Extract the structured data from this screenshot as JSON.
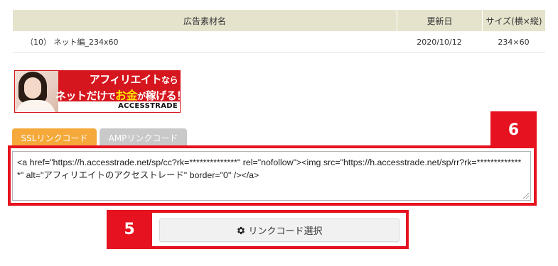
{
  "table": {
    "headers": [
      "広告素材名",
      "更新日",
      "サイズ(横×縦)"
    ],
    "rows": [
      [
        "（10） ネット編_234x60",
        "2020/10/12",
        "234×60"
      ]
    ]
  },
  "banner": {
    "line1_main": "アフィリエイト",
    "line1_small": "なら",
    "line2_a": "ネットだけ",
    "line2_b": "で",
    "line2_c": "お金",
    "line2_d": "が",
    "line2_e": "稼げる！",
    "logo": "ACCESSTRADE"
  },
  "tabs": {
    "ssl": "SSLリンクコード",
    "amp": "AMPリンクコード"
  },
  "code": {
    "text": "<a href=\"https://h.accesstrade.net/sp/cc?rk=**************\" rel=\"nofollow\"><img src=\"https://h.accesstrade.net/sp/rr?rk=**************\" alt=\"アフィリエイトのアクセストレード\" border=\"0\" /></a>"
  },
  "callouts": {
    "six": "6",
    "five": "5"
  },
  "button": {
    "label": "リンクコード選択",
    "icon": "gear-icon"
  },
  "colors": {
    "highlight": "#e6121f",
    "tab_active": "#f5a93b",
    "tab_inactive": "#c9c9c9",
    "table_header": "#e6e3cd",
    "banner_red": "#d6161e"
  }
}
